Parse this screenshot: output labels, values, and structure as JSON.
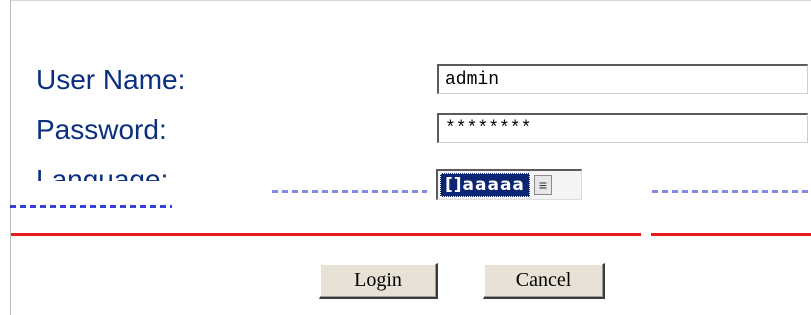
{
  "form": {
    "username": {
      "label": "User Name:",
      "value": "admin"
    },
    "password": {
      "label": "Password:",
      "value": "********"
    },
    "language": {
      "label": "Language:",
      "selected": "[]aaaaa"
    },
    "buttons": {
      "login": "Login",
      "cancel": "Cancel"
    }
  },
  "colors": {
    "label_text": "#0b2f7f",
    "divider": "#e61b1b",
    "selection_bg": "#0b2573",
    "button_face": "#e8e1d6"
  },
  "icons": {
    "select_arrow": "dropdown-arrow-icon"
  }
}
